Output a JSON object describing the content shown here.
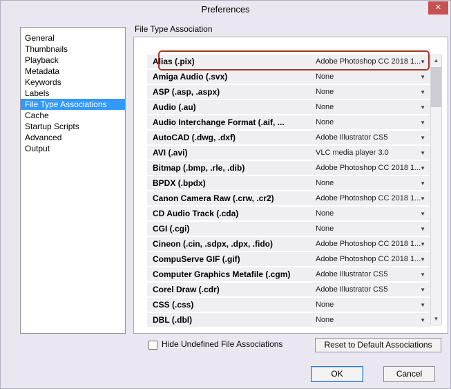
{
  "dialog": {
    "title": "Preferences",
    "close_icon": "✕"
  },
  "sidebar": {
    "items": [
      {
        "label": "General",
        "selected": false
      },
      {
        "label": "Thumbnails",
        "selected": false
      },
      {
        "label": "Playback",
        "selected": false
      },
      {
        "label": "Metadata",
        "selected": false
      },
      {
        "label": "Keywords",
        "selected": false
      },
      {
        "label": "Labels",
        "selected": false
      },
      {
        "label": "File Type Associations",
        "selected": true
      },
      {
        "label": "Cache",
        "selected": false
      },
      {
        "label": "Startup Scripts",
        "selected": false
      },
      {
        "label": "Advanced",
        "selected": false
      },
      {
        "label": "Output",
        "selected": false
      }
    ]
  },
  "main": {
    "section_title": "File Type Association",
    "dropdown_icon": "▼",
    "rows": [
      {
        "type": "Alias (.pix)",
        "association": "Adobe Photoshop CC 2018 1...",
        "annotated": true
      },
      {
        "type": "Amiga Audio (.svx)",
        "association": "None"
      },
      {
        "type": "ASP (.asp, .aspx)",
        "association": "None"
      },
      {
        "type": "Audio (.au)",
        "association": "None"
      },
      {
        "type": "Audio Interchange Format (.aif, ...",
        "association": "None"
      },
      {
        "type": "AutoCAD (.dwg, .dxf)",
        "association": "Adobe Illustrator CS5"
      },
      {
        "type": "AVI (.avi)",
        "association": "VLC media player 3.0"
      },
      {
        "type": "Bitmap (.bmp, .rle, .dib)",
        "association": "Adobe Photoshop CC 2018 1..."
      },
      {
        "type": "BPDX (.bpdx)",
        "association": "None"
      },
      {
        "type": "Canon Camera Raw (.crw, .cr2)",
        "association": "Adobe Photoshop CC 2018 1..."
      },
      {
        "type": "CD Audio Track (.cda)",
        "association": "None"
      },
      {
        "type": "CGI (.cgi)",
        "association": "None"
      },
      {
        "type": "Cineon (.cin, .sdpx, .dpx, .fido)",
        "association": "Adobe Photoshop CC 2018 1..."
      },
      {
        "type": "CompuServe GIF (.gif)",
        "association": "Adobe Photoshop CC 2018 1..."
      },
      {
        "type": "Computer Graphics Metafile (.cgm)",
        "association": "Adobe Illustrator CS5"
      },
      {
        "type": "Corel Draw (.cdr)",
        "association": "Adobe Illustrator CS5"
      },
      {
        "type": "CSS (.css)",
        "association": "None"
      },
      {
        "type": "DBL (.dbl)",
        "association": "None"
      }
    ]
  },
  "scrollbar": {
    "up_icon": "▲",
    "down_icon": "▼"
  },
  "footer": {
    "hide_checkbox_label": "Hide Undefined File Associations",
    "hide_checkbox_checked": false,
    "reset_button": "Reset to Default Associations",
    "ok_button": "OK",
    "cancel_button": "Cancel"
  },
  "colors": {
    "dialog_bg": "#eae7f1",
    "selection_blue": "#3399ff",
    "close_red": "#c75050",
    "annotation_red": "#a23425",
    "row_bg": "#efeef1"
  }
}
